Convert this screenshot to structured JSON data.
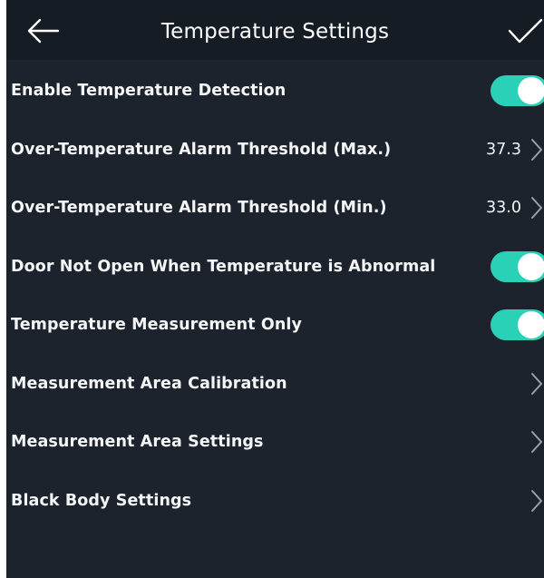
{
  "header": {
    "title": "Temperature Settings",
    "back_icon": "arrow-left-icon",
    "confirm_icon": "check-icon"
  },
  "colors": {
    "background": "#1c232c",
    "header_background": "#161c24",
    "toggle_on": "#2bd1b6",
    "text": "#f4f5f6",
    "chevron": "#9aa1aa"
  },
  "settings": [
    {
      "label": "Enable Temperature Detection",
      "control": "toggle",
      "on": true
    },
    {
      "label": "Over-Temperature Alarm Threshold (Max.)",
      "control": "value",
      "value": "37.3",
      "icon": "chevron-right-icon"
    },
    {
      "label": "Over-Temperature Alarm Threshold (Min.)",
      "control": "value",
      "value": "33.0",
      "icon": "chevron-right-icon"
    },
    {
      "label": "Door Not Open When Temperature is Abnormal",
      "control": "toggle",
      "on": true
    },
    {
      "label": "Temperature Measurement Only",
      "control": "toggle",
      "on": true
    },
    {
      "label": "Measurement Area Calibration",
      "control": "link",
      "icon": "chevron-right-icon"
    },
    {
      "label": "Measurement Area Settings",
      "control": "link",
      "icon": "chevron-right-icon"
    },
    {
      "label": "Black Body Settings",
      "control": "link",
      "icon": "chevron-right-icon"
    }
  ]
}
